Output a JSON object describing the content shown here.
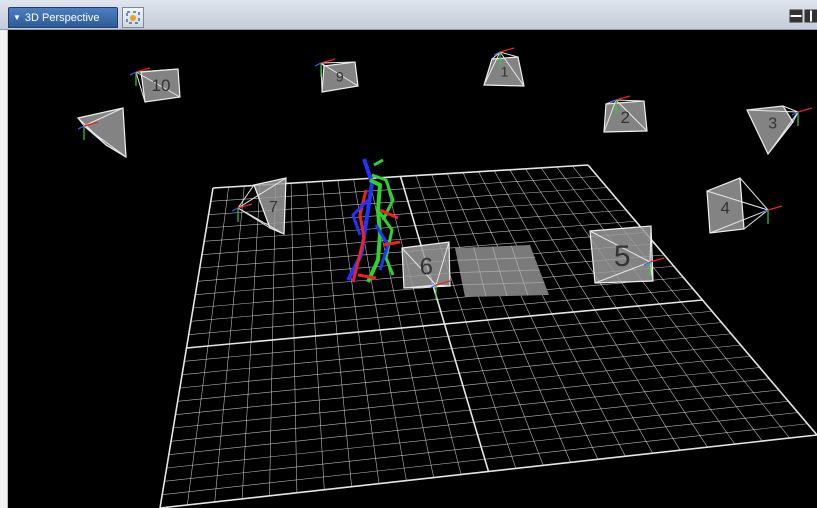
{
  "header": {
    "view_name": "3D Perspective",
    "view_menu_icon": "dropdown-triangle-icon",
    "fit_icon": "frame-selection-icon",
    "layout_buttons": [
      "split-horizontal-icon",
      "split-vertical-icon",
      "close-icon"
    ]
  },
  "scene": {
    "cameras": [
      {
        "label": "1"
      },
      {
        "label": "2"
      },
      {
        "label": "3"
      },
      {
        "label": "4"
      },
      {
        "label": "5"
      },
      {
        "label": "6"
      },
      {
        "label": "7"
      },
      {
        "label": "9"
      },
      {
        "label": "10"
      }
    ],
    "unlabeled_cameras": 1
  },
  "colors": {
    "header_bg": "#c9d1dc",
    "tab_bg": "#3466a8",
    "viewport_bg": "#000000",
    "grid": "#e6e6e6",
    "camera_face": "#9a9a9a",
    "skeleton_green": "#2fd12f",
    "skeleton_blue": "#2233ff",
    "skeleton_red": "#ee2222"
  }
}
